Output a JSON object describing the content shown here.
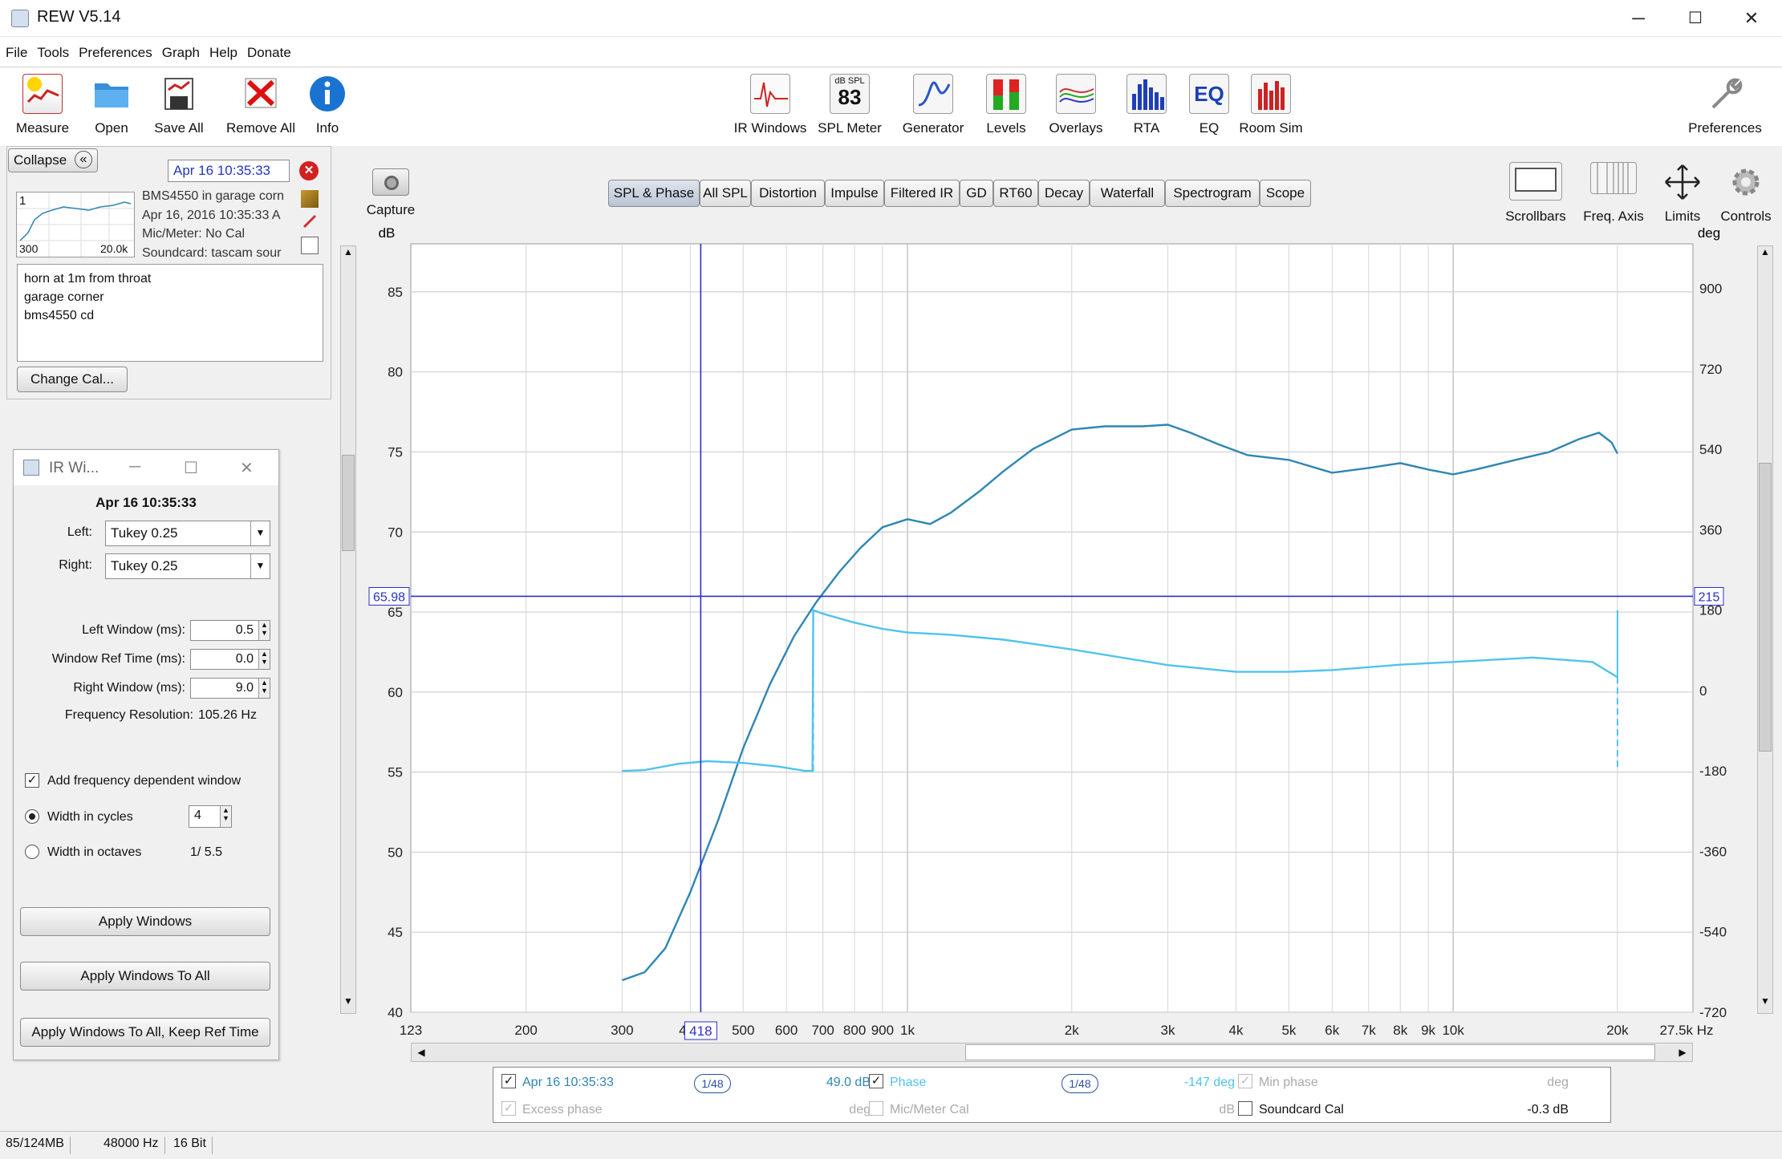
{
  "window": {
    "title": "REW V5.14",
    "minimize": "─",
    "maximize": "☐",
    "close": "✕"
  },
  "menu": [
    "File",
    "Tools",
    "Preferences",
    "Graph",
    "Help",
    "Donate"
  ],
  "toolbar_left": [
    {
      "label": "Measure",
      "icon": "measure-icon"
    },
    {
      "label": "Open",
      "icon": "folder-icon"
    },
    {
      "label": "Save All",
      "icon": "save-icon"
    },
    {
      "label": "Remove All",
      "icon": "remove-icon"
    },
    {
      "label": "Info",
      "icon": "info-icon"
    }
  ],
  "toolbar_center": [
    {
      "label": "IR Windows",
      "icon": "ir-windows-icon"
    },
    {
      "label": "SPL Meter",
      "icon": "spl-meter-icon",
      "badge_top": "dB SPL",
      "badge_value": "83"
    },
    {
      "label": "Generator",
      "icon": "generator-icon"
    },
    {
      "label": "Levels",
      "icon": "levels-icon"
    },
    {
      "label": "Overlays",
      "icon": "overlays-icon"
    },
    {
      "label": "RTA",
      "icon": "rta-icon"
    },
    {
      "label": "EQ",
      "icon": "eq-icon",
      "badge_value": "EQ"
    },
    {
      "label": "Room Sim",
      "icon": "room-sim-icon"
    }
  ],
  "toolbar_right": {
    "label": "Preferences",
    "icon": "wrench-icon"
  },
  "left_panel": {
    "collapse_label": "Collapse",
    "collapse_icon": "«",
    "measurement_name": "Apr 16 10:35:33",
    "thumb_index": "1",
    "thumb_xmin": "300",
    "thumb_xmax": "20.0k",
    "info_lines": [
      "BMS4550 in garage corn",
      "Apr 16, 2016 10:35:33 A",
      "Mic/Meter: No Cal",
      "Soundcard: tascam sour"
    ],
    "notes": [
      "horn at 1m from throat",
      "garage corner",
      "bms4550 cd"
    ],
    "change_cal_label": "Change Cal..."
  },
  "ir_window": {
    "title": "IR Wi...",
    "heading": "Apr 16 10:35:33",
    "left_label": "Left:",
    "left_value": "Tukey 0.25",
    "right_label": "Right:",
    "right_value": "Tukey 0.25",
    "left_window_label": "Left Window (ms):",
    "left_window_value": "0.5",
    "ref_time_label": "Window Ref Time (ms):",
    "ref_time_value": "0.0",
    "right_window_label": "Right Window (ms):",
    "right_window_value": "9.0",
    "freq_res_label": "Frequency Resolution:",
    "freq_res_value": "105.26 Hz",
    "fdw_label": "Add frequency dependent window",
    "fdw_checked": true,
    "cycles_label": "Width in cycles",
    "cycles_value": "4",
    "octaves_label": "Width in octaves",
    "octaves_value": "1/ 5.5",
    "apply_label": "Apply Windows",
    "apply_all_label": "Apply Windows To All",
    "apply_all_keep_label": "Apply Windows To All, Keep Ref Time"
  },
  "capture": {
    "label": "Capture",
    "icon": "camera-icon"
  },
  "tabs": [
    "SPL & Phase",
    "All SPL",
    "Distortion",
    "Impulse",
    "Filtered IR",
    "GD",
    "RT60",
    "Decay",
    "Waterfall",
    "Spectrogram",
    "Scope"
  ],
  "active_tab": "SPL & Phase",
  "graph_controls": [
    {
      "label": "Scrollbars",
      "icon": "scrollbars-icon"
    },
    {
      "label": "Freq. Axis",
      "icon": "freq-axis-icon"
    },
    {
      "label": "Limits",
      "icon": "limits-icon"
    },
    {
      "label": "Controls",
      "icon": "gear-icon"
    }
  ],
  "chart_data": {
    "type": "line",
    "ylabel": "dB",
    "y2label": "deg",
    "xscale": "log",
    "xlim": [
      123,
      27500
    ],
    "ylim": [
      40,
      88
    ],
    "y2lim": [
      -720,
      1000
    ],
    "x_tick_labels": [
      "123",
      "200",
      "300",
      "400",
      "500",
      "600",
      "700",
      "800",
      "900",
      "1k",
      "2k",
      "3k",
      "4k",
      "5k",
      "6k",
      "7k",
      "8k",
      "9k",
      "10k",
      "20k",
      "27.5k Hz"
    ],
    "y_tick_labels": [
      "85",
      "80",
      "75",
      "70",
      "65",
      "60",
      "55",
      "50",
      "45",
      "40"
    ],
    "y2_tick_labels": [
      "900",
      "720",
      "540",
      "360",
      "180",
      "0",
      "-180",
      "-360",
      "-540",
      "-720"
    ],
    "cursor": {
      "x": 418,
      "y": 65.98,
      "x_label": "418",
      "y_label": "65.98",
      "y2_label": "215"
    },
    "series": [
      {
        "name": "Apr 16 10:35:33",
        "color": "#2f86b3",
        "axis": "left",
        "x": [
          300,
          330,
          360,
          400,
          450,
          500,
          560,
          620,
          680,
          750,
          820,
          900,
          1000,
          1100,
          1200,
          1350,
          1500,
          1700,
          2000,
          2300,
          2700,
          3000,
          3300,
          3700,
          4200,
          5000,
          6000,
          7000,
          8000,
          9000,
          10000,
          11000,
          13000,
          15000,
          17000,
          18500,
          19500,
          20000
        ],
        "y": [
          42,
          42.5,
          44,
          47.5,
          52,
          56.5,
          60.5,
          63.5,
          65.6,
          67.5,
          69,
          70.3,
          70.8,
          70.5,
          71.2,
          72.5,
          73.8,
          75.2,
          76.4,
          76.6,
          76.6,
          76.7,
          76.2,
          75.5,
          74.8,
          74.5,
          73.7,
          74,
          74.3,
          73.9,
          73.6,
          73.9,
          74.5,
          75,
          75.8,
          76.2,
          75.6,
          74.9
        ]
      },
      {
        "name": "Phase",
        "color": "#4fc3ee",
        "axis": "right",
        "x": [
          300,
          330,
          380,
          430,
          500,
          580,
          650,
          670,
          672,
          700,
          800,
          900,
          1000,
          1200,
          1500,
          2000,
          3000,
          4000,
          5000,
          6000,
          8000,
          10000,
          14000,
          18000,
          20000
        ],
        "y": [
          -180,
          -178,
          -164,
          -158,
          -162,
          -170,
          -180,
          -180,
          180,
          172,
          152,
          138,
          130,
          125,
          114,
          92,
          57,
          42,
          42,
          46,
          58,
          64,
          74,
          64,
          30
        ]
      }
    ]
  },
  "legend": {
    "row1": [
      {
        "name": "Apr 16 10:35:33",
        "checked": true,
        "smoothing": "1/48",
        "value": "49.0 dB",
        "color": "#2f86b3"
      },
      {
        "name": "Phase",
        "checked": true,
        "smoothing": "1/48",
        "value": "-147 deg",
        "color": "#4fc3ee"
      },
      {
        "name": "Min phase",
        "checked": true,
        "value": "deg",
        "disabled": true
      }
    ],
    "row2": [
      {
        "name": "Excess phase",
        "checked": true,
        "value": "deg",
        "disabled": true
      },
      {
        "name": "Mic/Meter Cal",
        "checked": false,
        "value": "dB",
        "disabled": true
      },
      {
        "name": "Soundcard Cal",
        "checked": false,
        "value": "-0.3 dB"
      }
    ]
  },
  "status": [
    "85/124MB",
    "48000 Hz",
    "16 Bit"
  ]
}
